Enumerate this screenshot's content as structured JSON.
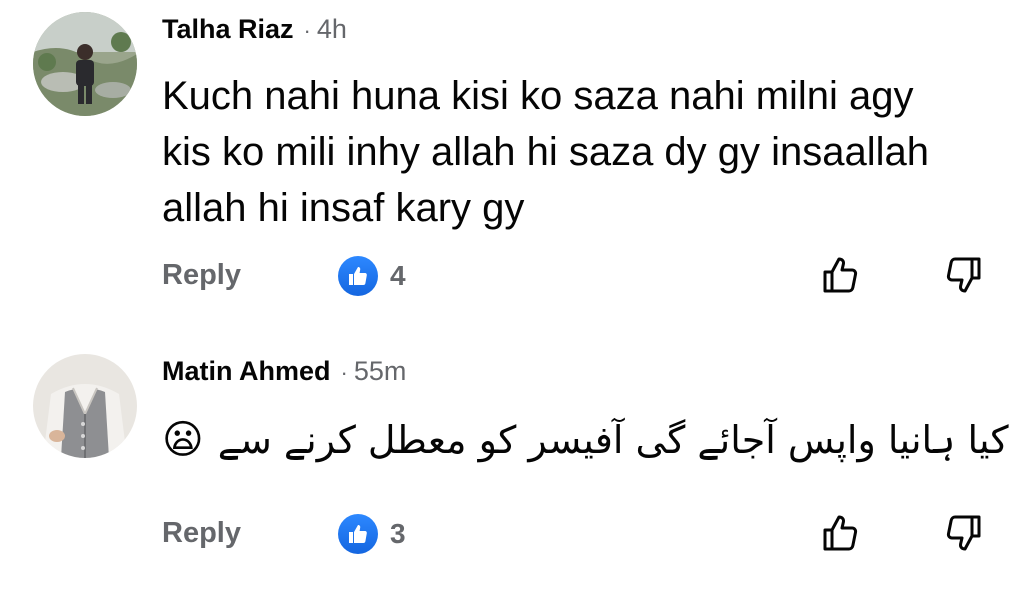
{
  "comments": [
    {
      "author": "Talha Riaz",
      "separator": "·",
      "time": "4h",
      "lines": [
        "Kuch nahi huna kisi ko saza nahi milni agy",
        "kis ko mili inhy allah hi saza dy gy insaallah",
        "allah hi insaf kary gy"
      ],
      "reply_label": "Reply",
      "like_count": "4",
      "avatar_icon": "outdoor-photo-avatar"
    },
    {
      "author": "Matin Ahmed",
      "separator": "·",
      "time": "55m",
      "emoji": "😦",
      "text": "کیا ہانیا واپس آجائے گی آفیسر کو معطل کرنے سے",
      "reply_label": "Reply",
      "like_count": "3",
      "avatar_icon": "vest-photo-avatar"
    }
  ],
  "colors": {
    "secondary_text": "#65676b",
    "like_blue": "#1877f2",
    "primary_text": "#050505"
  }
}
